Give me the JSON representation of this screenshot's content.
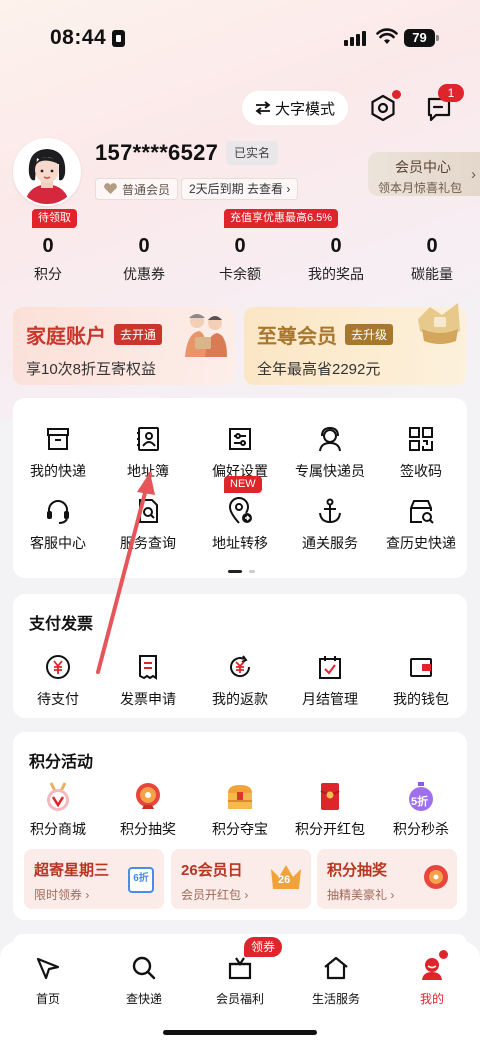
{
  "status_bar": {
    "time": "08:44",
    "battery": "79"
  },
  "header": {
    "big_font_mode": "大字模式",
    "message_count": "1"
  },
  "profile": {
    "phone": "157****6527",
    "verified": "已实名",
    "member_level": "普通会员",
    "expire_notice": "2天后到期 去查看",
    "member_center_title": "会员中心",
    "member_center_sub": "领本月惊喜礼包"
  },
  "stats": {
    "badge_points": "待领取",
    "badge_card": "充值享优惠最高6.5%",
    "items": [
      {
        "value": "0",
        "label": "积分"
      },
      {
        "value": "0",
        "label": "优惠券"
      },
      {
        "value": "0",
        "label": "卡余额"
      },
      {
        "value": "0",
        "label": "我的奖品"
      },
      {
        "value": "0",
        "label": "碳能量"
      }
    ]
  },
  "cards": {
    "family": {
      "title": "家庭账户",
      "pill": "去开通",
      "sub": "享10次8折互寄权益"
    },
    "vip": {
      "title": "至尊会员",
      "pill": "去升级",
      "sub": "全年最高省2292元"
    }
  },
  "services": {
    "new_badge": "NEW",
    "row1": [
      "我的快递",
      "地址簿",
      "偏好设置",
      "专属快递员",
      "签收码"
    ],
    "row2": [
      "客服中心",
      "服务查询",
      "地址转移",
      "通关服务",
      "查历史快递"
    ]
  },
  "payment": {
    "title": "支付发票",
    "items": [
      "待支付",
      "发票申请",
      "我的返款",
      "月结管理",
      "我的钱包"
    ]
  },
  "points_activity": {
    "title": "积分活动",
    "items": [
      "积分商城",
      "积分抽奖",
      "积分夺宝",
      "积分开红包",
      "积分秒杀"
    ],
    "sec_kill_badge": "5折",
    "promos": [
      {
        "title": "超寄星期三",
        "sub": "限时领券",
        "badge": "6折"
      },
      {
        "title": "26会员日",
        "sub": "会员开红包",
        "badge": "26"
      },
      {
        "title": "积分抽奖",
        "sub": "抽精美豪礼"
      }
    ]
  },
  "tabbar": {
    "coupon_badge": "领券",
    "items": [
      "首页",
      "查快递",
      "会员福利",
      "生活服务",
      "我的"
    ]
  },
  "colors": {
    "accent": "#e0242b",
    "gold": "#a7772f"
  }
}
